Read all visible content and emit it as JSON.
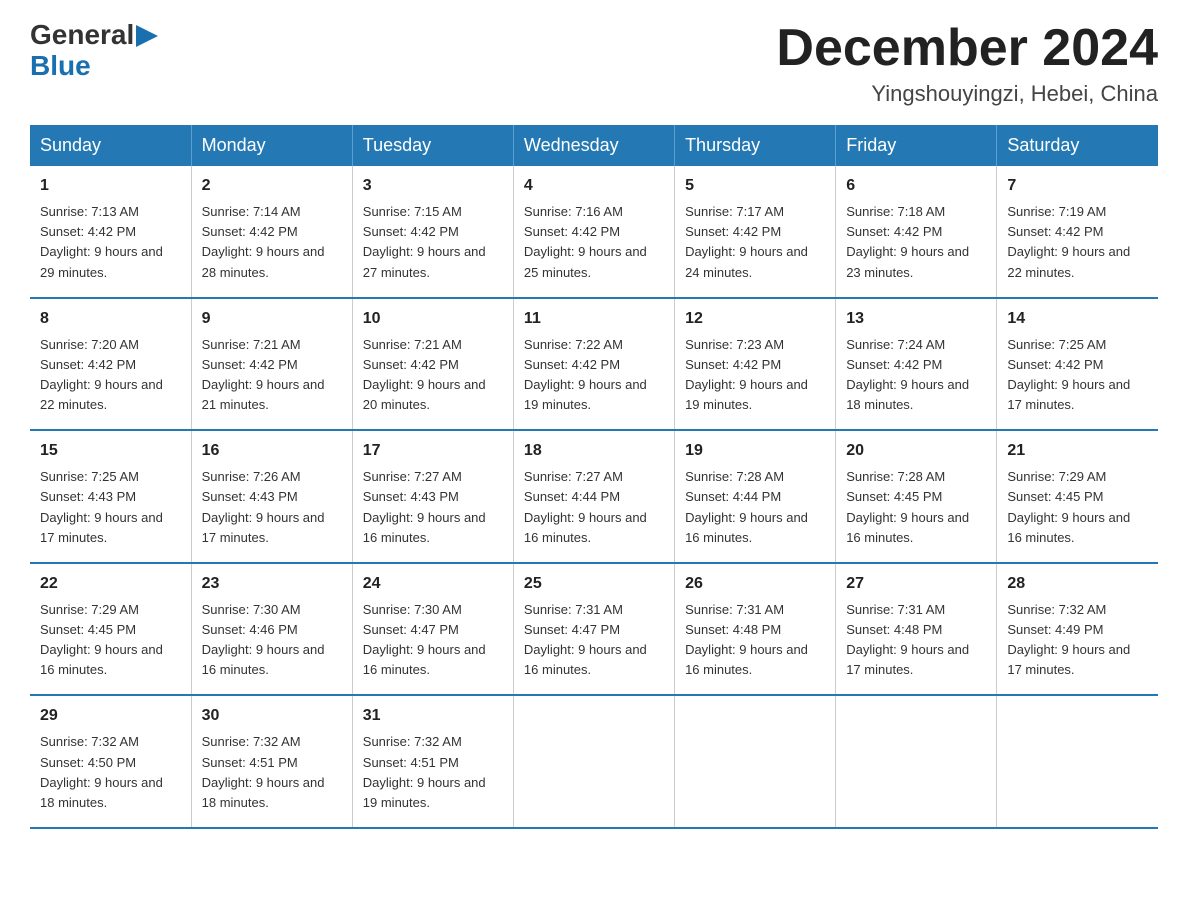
{
  "logo": {
    "general": "General",
    "blue": "Blue"
  },
  "header": {
    "title": "December 2024",
    "location": "Yingshouyingzi, Hebei, China"
  },
  "weekdays": [
    "Sunday",
    "Monday",
    "Tuesday",
    "Wednesday",
    "Thursday",
    "Friday",
    "Saturday"
  ],
  "weeks": [
    [
      {
        "day": "1",
        "sunrise": "7:13 AM",
        "sunset": "4:42 PM",
        "daylight": "9 hours and 29 minutes."
      },
      {
        "day": "2",
        "sunrise": "7:14 AM",
        "sunset": "4:42 PM",
        "daylight": "9 hours and 28 minutes."
      },
      {
        "day": "3",
        "sunrise": "7:15 AM",
        "sunset": "4:42 PM",
        "daylight": "9 hours and 27 minutes."
      },
      {
        "day": "4",
        "sunrise": "7:16 AM",
        "sunset": "4:42 PM",
        "daylight": "9 hours and 25 minutes."
      },
      {
        "day": "5",
        "sunrise": "7:17 AM",
        "sunset": "4:42 PM",
        "daylight": "9 hours and 24 minutes."
      },
      {
        "day": "6",
        "sunrise": "7:18 AM",
        "sunset": "4:42 PM",
        "daylight": "9 hours and 23 minutes."
      },
      {
        "day": "7",
        "sunrise": "7:19 AM",
        "sunset": "4:42 PM",
        "daylight": "9 hours and 22 minutes."
      }
    ],
    [
      {
        "day": "8",
        "sunrise": "7:20 AM",
        "sunset": "4:42 PM",
        "daylight": "9 hours and 22 minutes."
      },
      {
        "day": "9",
        "sunrise": "7:21 AM",
        "sunset": "4:42 PM",
        "daylight": "9 hours and 21 minutes."
      },
      {
        "day": "10",
        "sunrise": "7:21 AM",
        "sunset": "4:42 PM",
        "daylight": "9 hours and 20 minutes."
      },
      {
        "day": "11",
        "sunrise": "7:22 AM",
        "sunset": "4:42 PM",
        "daylight": "9 hours and 19 minutes."
      },
      {
        "day": "12",
        "sunrise": "7:23 AM",
        "sunset": "4:42 PM",
        "daylight": "9 hours and 19 minutes."
      },
      {
        "day": "13",
        "sunrise": "7:24 AM",
        "sunset": "4:42 PM",
        "daylight": "9 hours and 18 minutes."
      },
      {
        "day": "14",
        "sunrise": "7:25 AM",
        "sunset": "4:42 PM",
        "daylight": "9 hours and 17 minutes."
      }
    ],
    [
      {
        "day": "15",
        "sunrise": "7:25 AM",
        "sunset": "4:43 PM",
        "daylight": "9 hours and 17 minutes."
      },
      {
        "day": "16",
        "sunrise": "7:26 AM",
        "sunset": "4:43 PM",
        "daylight": "9 hours and 17 minutes."
      },
      {
        "day": "17",
        "sunrise": "7:27 AM",
        "sunset": "4:43 PM",
        "daylight": "9 hours and 16 minutes."
      },
      {
        "day": "18",
        "sunrise": "7:27 AM",
        "sunset": "4:44 PM",
        "daylight": "9 hours and 16 minutes."
      },
      {
        "day": "19",
        "sunrise": "7:28 AM",
        "sunset": "4:44 PM",
        "daylight": "9 hours and 16 minutes."
      },
      {
        "day": "20",
        "sunrise": "7:28 AM",
        "sunset": "4:45 PM",
        "daylight": "9 hours and 16 minutes."
      },
      {
        "day": "21",
        "sunrise": "7:29 AM",
        "sunset": "4:45 PM",
        "daylight": "9 hours and 16 minutes."
      }
    ],
    [
      {
        "day": "22",
        "sunrise": "7:29 AM",
        "sunset": "4:45 PM",
        "daylight": "9 hours and 16 minutes."
      },
      {
        "day": "23",
        "sunrise": "7:30 AM",
        "sunset": "4:46 PM",
        "daylight": "9 hours and 16 minutes."
      },
      {
        "day": "24",
        "sunrise": "7:30 AM",
        "sunset": "4:47 PM",
        "daylight": "9 hours and 16 minutes."
      },
      {
        "day": "25",
        "sunrise": "7:31 AM",
        "sunset": "4:47 PM",
        "daylight": "9 hours and 16 minutes."
      },
      {
        "day": "26",
        "sunrise": "7:31 AM",
        "sunset": "4:48 PM",
        "daylight": "9 hours and 16 minutes."
      },
      {
        "day": "27",
        "sunrise": "7:31 AM",
        "sunset": "4:48 PM",
        "daylight": "9 hours and 17 minutes."
      },
      {
        "day": "28",
        "sunrise": "7:32 AM",
        "sunset": "4:49 PM",
        "daylight": "9 hours and 17 minutes."
      }
    ],
    [
      {
        "day": "29",
        "sunrise": "7:32 AM",
        "sunset": "4:50 PM",
        "daylight": "9 hours and 18 minutes."
      },
      {
        "day": "30",
        "sunrise": "7:32 AM",
        "sunset": "4:51 PM",
        "daylight": "9 hours and 18 minutes."
      },
      {
        "day": "31",
        "sunrise": "7:32 AM",
        "sunset": "4:51 PM",
        "daylight": "9 hours and 19 minutes."
      },
      null,
      null,
      null,
      null
    ]
  ]
}
